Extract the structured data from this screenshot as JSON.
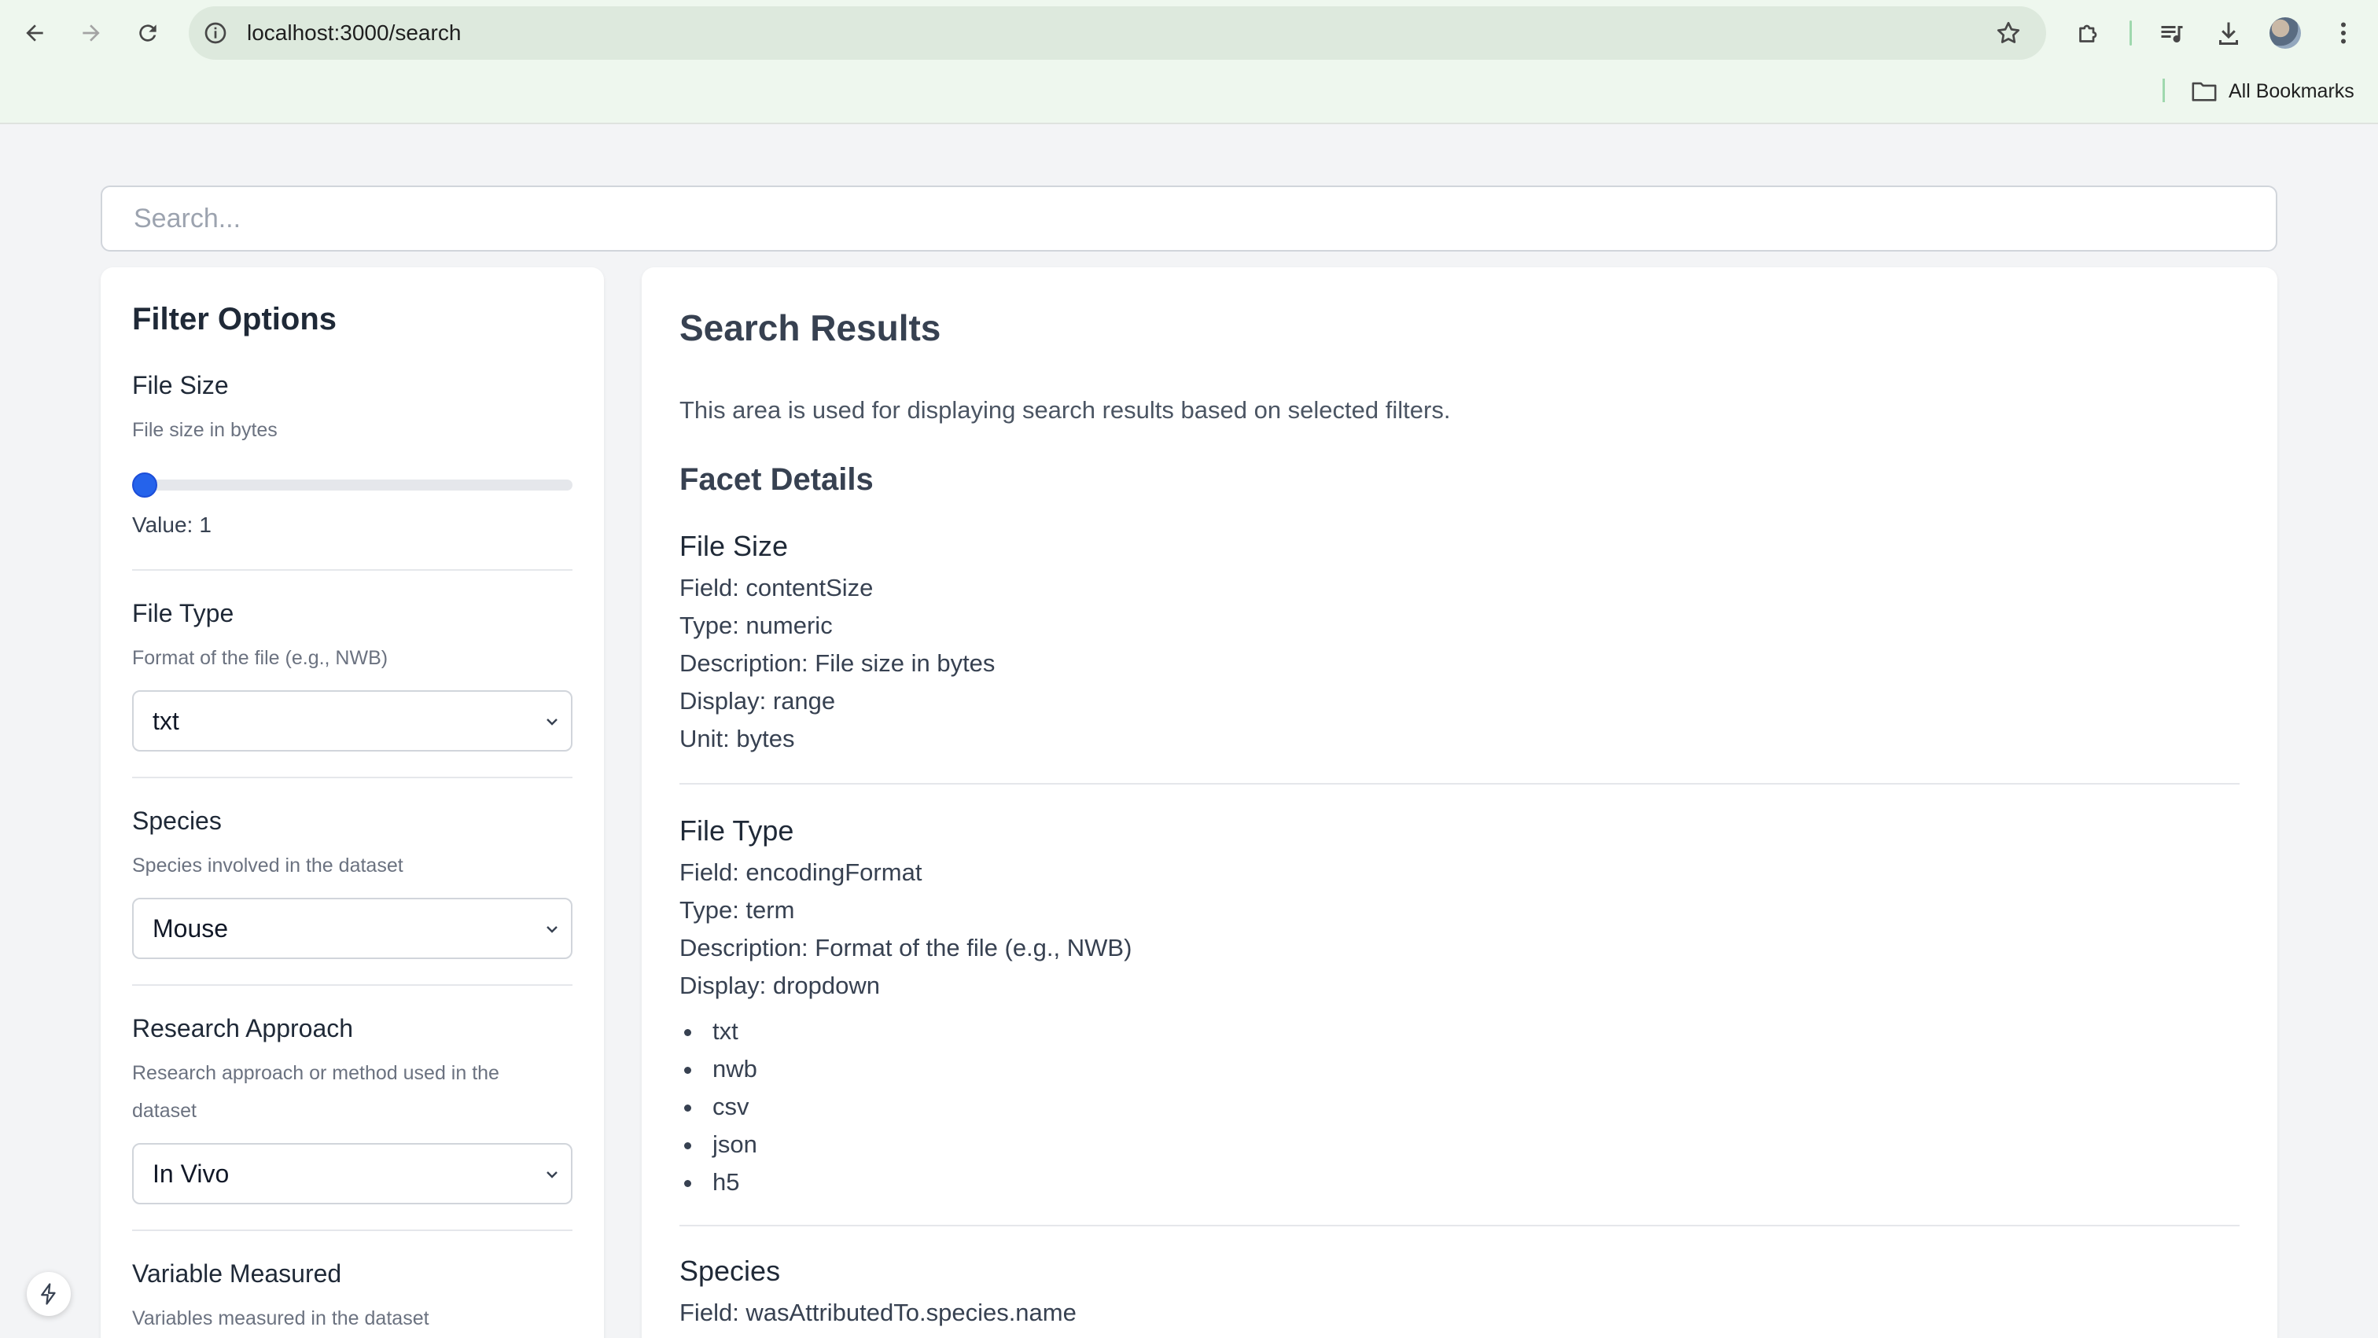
{
  "browser": {
    "url": "localhost:3000/search",
    "bookmarks_label": "All Bookmarks"
  },
  "search": {
    "placeholder": "Search...",
    "value": ""
  },
  "sidebar": {
    "title": "Filter Options",
    "file_size": {
      "title": "File Size",
      "description": "File size in bytes",
      "value_label": "Value:",
      "value": "1"
    },
    "file_type": {
      "title": "File Type",
      "description": "Format of the file (e.g., NWB)",
      "selected": "txt"
    },
    "species": {
      "title": "Species",
      "description": "Species involved in the dataset",
      "selected": "Mouse"
    },
    "research_approach": {
      "title": "Research Approach",
      "description_line1": "Research approach or method used in the",
      "description_line2": "dataset",
      "selected": "In Vivo"
    },
    "variable_measured": {
      "title": "Variable Measured",
      "description": "Variables measured in the dataset"
    }
  },
  "results": {
    "title": "Search Results",
    "intro": "This area is used for displaying search results based on selected filters.",
    "facet_details_title": "Facet Details",
    "facets": [
      {
        "title": "File Size",
        "lines": [
          "Field: contentSize",
          "Type: numeric",
          "Description: File size in bytes",
          "Display: range",
          "Unit: bytes"
        ]
      },
      {
        "title": "File Type",
        "lines": [
          "Field: encodingFormat",
          "Type: term",
          "Description: Format of the file (e.g., NWB)",
          "Display: dropdown"
        ],
        "options": [
          "txt",
          "nwb",
          "csv",
          "json",
          "h5"
        ]
      },
      {
        "title": "Species",
        "lines": [
          "Field: wasAttributedTo.species.name"
        ]
      }
    ]
  }
}
